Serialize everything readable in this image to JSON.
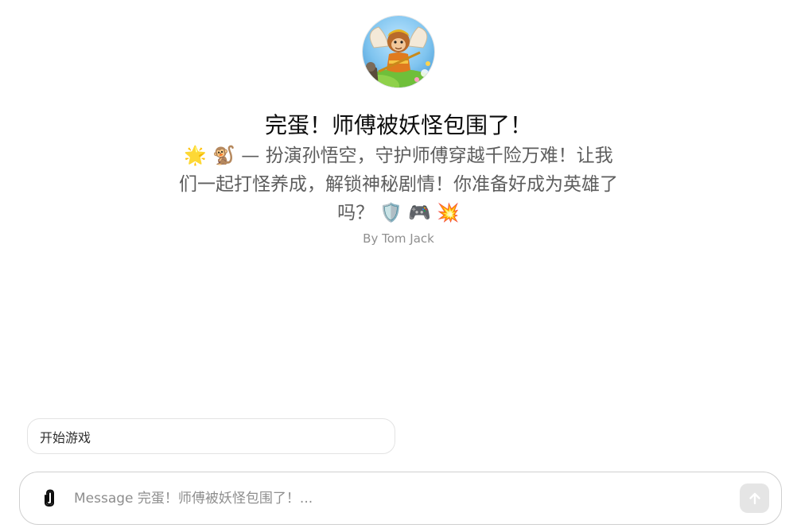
{
  "gpt": {
    "title": "完蛋！师傅被妖怪包围了！",
    "description": "🌟 🐒 — 扮演孙悟空，守护师傅穿越千险万难！让我们一起打怪养成，解锁神秘剧情！你准备好成为英雄了吗？ 🛡️ 🎮 💥",
    "author": "By Tom Jack",
    "avatar_icon": "monkey-king-avatar"
  },
  "conversation_starters": [
    {
      "label": "开始游戏"
    }
  ],
  "composer": {
    "placeholder": "Message 完蛋！师傅被妖怪包围了！...",
    "value": "",
    "attach_icon": "paperclip-icon",
    "send_icon": "arrow-up-icon"
  },
  "colors": {
    "send_button_disabled": "#e5e5e5",
    "border": "#cfcfcf"
  }
}
